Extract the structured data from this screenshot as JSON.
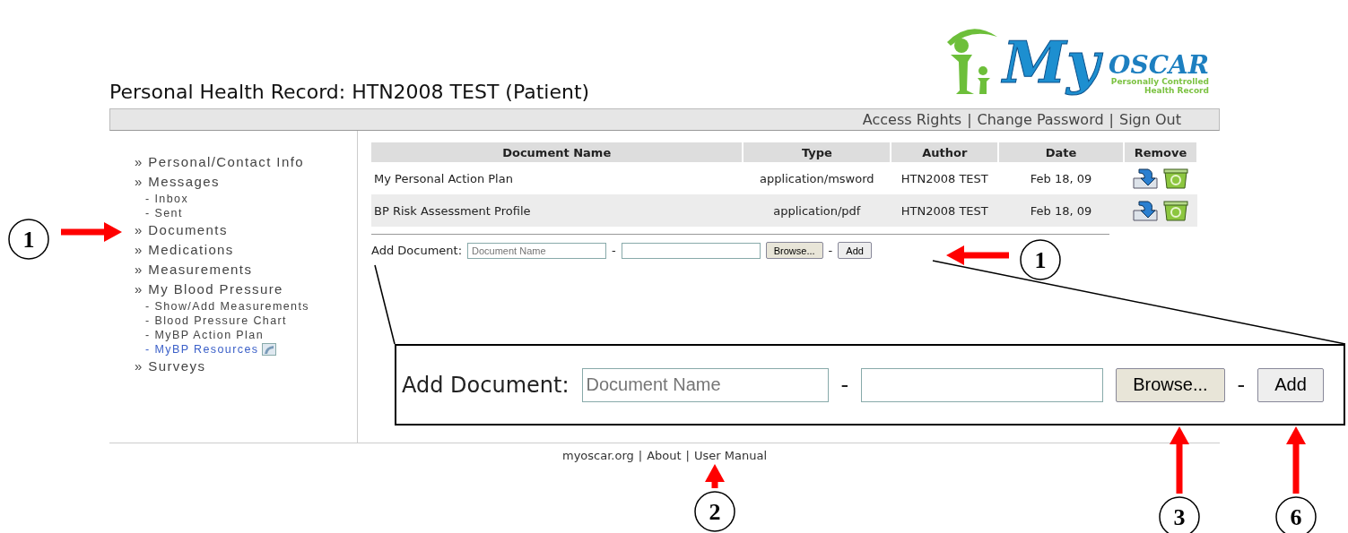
{
  "header": {
    "title": "Personal Health Record: HTN2008 TEST (Patient)",
    "logo": {
      "wordmark_big": "My",
      "wordmark_small": "OSCAR",
      "tagline": [
        "Personally Controlled",
        "Health Record"
      ]
    }
  },
  "top_links": {
    "separator": "|",
    "items": [
      "Access Rights",
      "Change Password",
      "Sign Out"
    ]
  },
  "sidebar": {
    "items": [
      {
        "marker": "»",
        "label": "Personal/Contact Info"
      },
      {
        "marker": "»",
        "label": "Messages",
        "children": [
          {
            "marker": "-",
            "label": "Inbox",
            "kind": "plain"
          },
          {
            "marker": "-",
            "label": "Sent",
            "kind": "plain"
          }
        ]
      },
      {
        "marker": "»",
        "label": "Documents"
      },
      {
        "marker": "»",
        "label": "Medications"
      },
      {
        "marker": "»",
        "label": "Measurements"
      },
      {
        "marker": "»",
        "label": "My Blood Pressure",
        "children": [
          {
            "marker": "-",
            "label": "Show/Add Measurements",
            "kind": "plain"
          },
          {
            "marker": "-",
            "label": "Blood Pressure Chart",
            "kind": "plain"
          },
          {
            "marker": "-",
            "label": "MyBP Action Plan",
            "kind": "plain"
          },
          {
            "marker": "-",
            "label": "MyBP Resources",
            "kind": "external"
          }
        ]
      },
      {
        "marker": "»",
        "label": "Surveys"
      }
    ]
  },
  "table": {
    "columns": [
      "Document Name",
      "Type",
      "Author",
      "Date",
      "Remove"
    ],
    "rows": [
      {
        "name": "My Personal Action Plan",
        "type": "application/msword",
        "author": "HTN2008 TEST",
        "date": "Feb 18, 09"
      },
      {
        "name": "BP Risk Assessment Profile",
        "type": "application/pdf",
        "author": "HTN2008 TEST",
        "date": "Feb 18, 09"
      }
    ]
  },
  "add_form": {
    "label": "Add Document:",
    "placeholder": "Document Name",
    "separator": "-",
    "browse": "Browse...",
    "add": "Add"
  },
  "zoom_callout": {
    "label": "Add Document:",
    "placeholder": "Document Name",
    "separator": "-",
    "browse": "Browse...",
    "add": "Add"
  },
  "footer": {
    "separator": "|",
    "links": [
      "myoscar.org",
      "About",
      "User Manual"
    ]
  },
  "annotations": [
    {
      "number": "1"
    },
    {
      "number": "1"
    },
    {
      "number": "2"
    },
    {
      "number": "3"
    },
    {
      "number": "6"
    }
  ]
}
